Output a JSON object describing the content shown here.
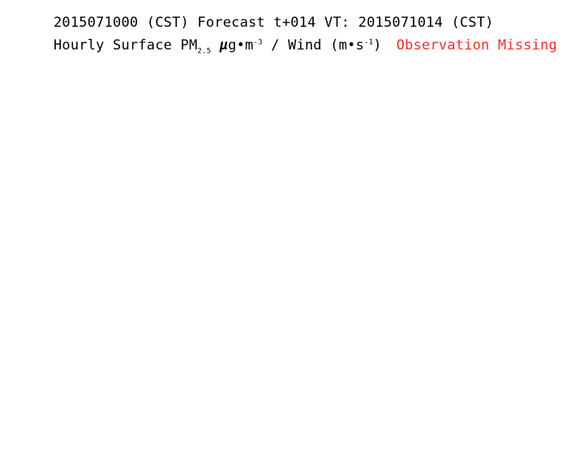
{
  "title_line_1": "2015071000 (CST) Forecast t+014 VT: 2015071014 (CST)",
  "title_line_2": {
    "prefix": "Hourly Surface PM",
    "subscript": "2.5",
    "unit_mu": "μ",
    "unit_g_m": "g•m",
    "unit_exp": "-3",
    "wind": " / Wind (m•s",
    "wind_exp": "-1",
    "wind_close": ")",
    "status": "Observation Missing"
  },
  "colors": {
    "background": "#ffffff",
    "text": "#000000",
    "status": "#ff2a2a"
  }
}
